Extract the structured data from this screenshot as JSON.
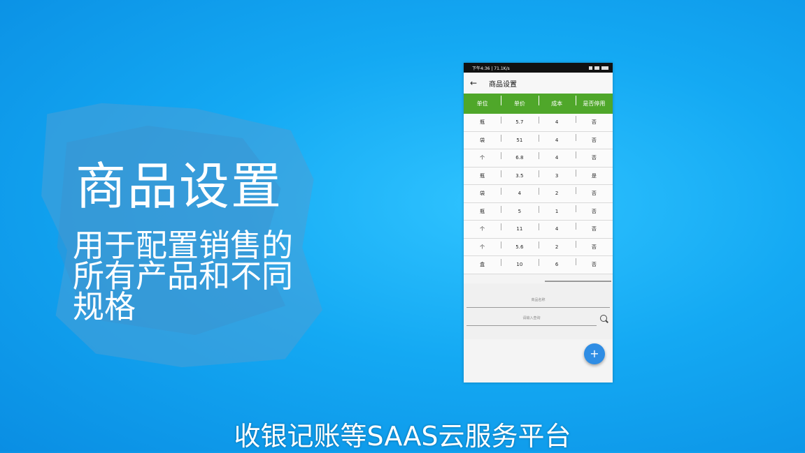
{
  "overlay": {
    "title": "商品设置",
    "description": "用于配置销售的所有产品和不同规格",
    "subtitle": "收银记账等SAAS云服务平台"
  },
  "phone": {
    "status_bar": {
      "time_text": "下午4:36 | 71.1K/s"
    },
    "app_bar": {
      "title": "商品设置",
      "back_icon": "arrow-left-icon"
    },
    "table": {
      "header_color": "#4fa72a",
      "columns": [
        "单位",
        "单价",
        "成本",
        "是否停用"
      ],
      "rows": [
        [
          "瓶",
          "5.7",
          "4",
          "否"
        ],
        [
          "袋",
          "51",
          "4",
          "否"
        ],
        [
          "个",
          "6.8",
          "4",
          "否"
        ],
        [
          "瓶",
          "3.5",
          "3",
          "是"
        ],
        [
          "袋",
          "4",
          "2",
          "否"
        ],
        [
          "瓶",
          "5",
          "1",
          "否"
        ],
        [
          "个",
          "11",
          "4",
          "否"
        ],
        [
          "个",
          "5.6",
          "2",
          "否"
        ],
        [
          "盒",
          "10",
          "6",
          "否"
        ]
      ]
    },
    "inputs": {
      "name_placeholder": "商品名称",
      "search_placeholder": "请输入查询"
    },
    "fab": {
      "label": "+",
      "icon": "add-icon",
      "color": "#2f8de4"
    }
  }
}
